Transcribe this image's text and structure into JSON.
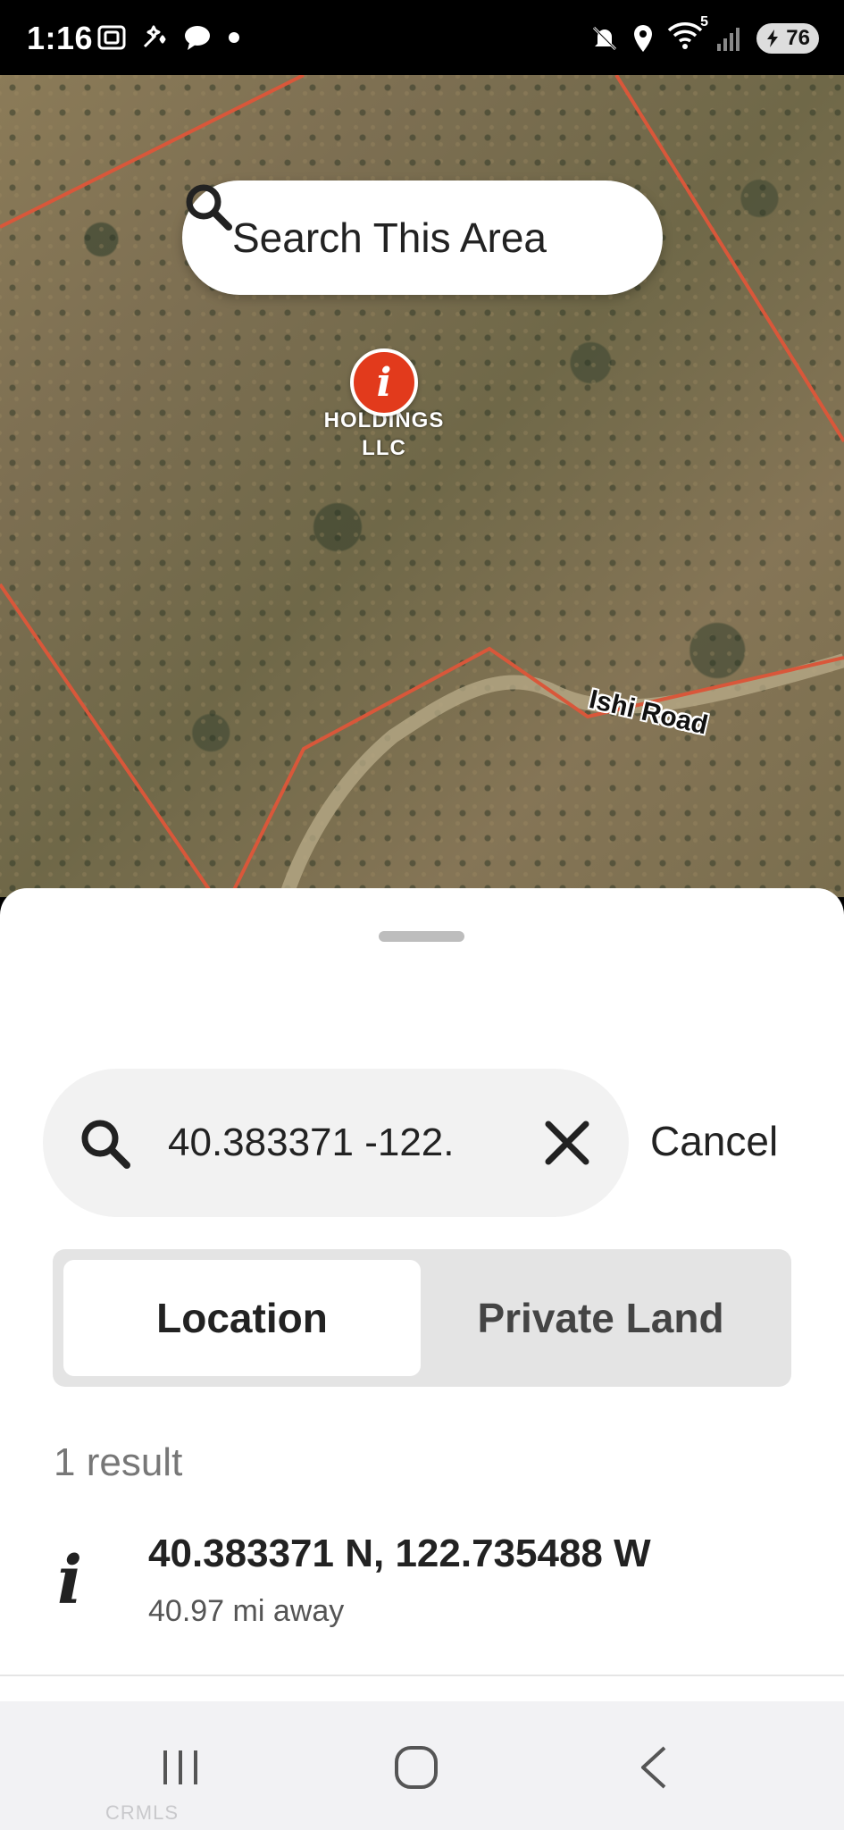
{
  "status_bar": {
    "time": "1:16",
    "battery_level": "76",
    "network_badge": "5",
    "icons_left": [
      "screenshot-icon",
      "spark-icon",
      "chat-bubble-icon",
      "dot-icon"
    ],
    "icons_right": [
      "mute-icon",
      "location-icon",
      "wifi-icon",
      "signal-icon",
      "battery-icon"
    ]
  },
  "map": {
    "search_area_label": "Search This Area",
    "poi_label": "A N\nHOLDINGS\nLLC",
    "road_label": "Ishi Road",
    "parcel_line_color": "#d9573a"
  },
  "sheet": {
    "search": {
      "value": "40.383371 -122.",
      "cancel_label": "Cancel"
    },
    "tabs": [
      {
        "label": "Location",
        "selected": true
      },
      {
        "label": "Private Land",
        "selected": false
      }
    ],
    "result_count": "1 result",
    "results": [
      {
        "title": "40.383371 N, 122.735488 W",
        "subtitle": "40.97 mi away"
      }
    ]
  },
  "nav_bar": {
    "buttons": [
      "recents",
      "home",
      "back"
    ],
    "watermark": "CRMLS"
  }
}
